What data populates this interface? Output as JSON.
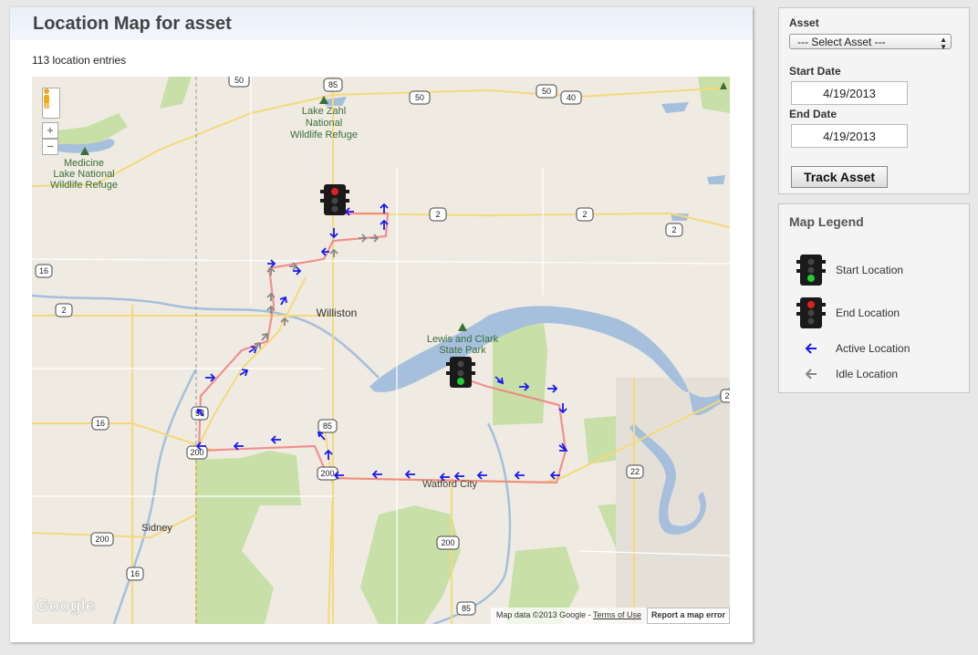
{
  "page": {
    "title": "Location Map for asset",
    "entries_text": "113 location entries"
  },
  "asset_form": {
    "asset_label": "Asset",
    "asset_select_value": "--- Select Asset ---",
    "start_label": "Start Date",
    "start_value": "4/19/2013",
    "end_label": "End Date",
    "end_value": "4/19/2013",
    "track_button": "Track Asset"
  },
  "legend": {
    "title": "Map Legend",
    "items": [
      {
        "label": "Start Location",
        "icon": "traffic-light-green"
      },
      {
        "label": "End Location",
        "icon": "traffic-light-red"
      },
      {
        "label": "Active Location",
        "icon": "blue-arrow"
      },
      {
        "label": "Idle Location",
        "icon": "gray-arrow"
      }
    ]
  },
  "map": {
    "places": [
      "Lake Zahl",
      "National",
      "Wildlife Refuge",
      "Medicine",
      "Lake National",
      "Wildlife Refuge",
      "Williston",
      "Lewis and Clark",
      "State Park",
      "Watford City",
      "Sidney"
    ],
    "road_shields": [
      "50",
      "50",
      "50",
      "40",
      "85",
      "2",
      "2",
      "2",
      "16",
      "2",
      "16",
      "58",
      "85",
      "200",
      "200",
      "22",
      "200",
      "16",
      "200",
      "85",
      "2"
    ],
    "zoom_in": "+",
    "zoom_out": "−",
    "attribution": "Map data ©2013 Google - ",
    "terms": "Terms of Use",
    "report": "Report a map error",
    "logo": "Google"
  },
  "colors": {
    "active_arrow": "#1a1aee",
    "idle_arrow": "#888888",
    "route": "#f08080",
    "water": "#a5bfdd",
    "park": "#c8dfa8"
  }
}
